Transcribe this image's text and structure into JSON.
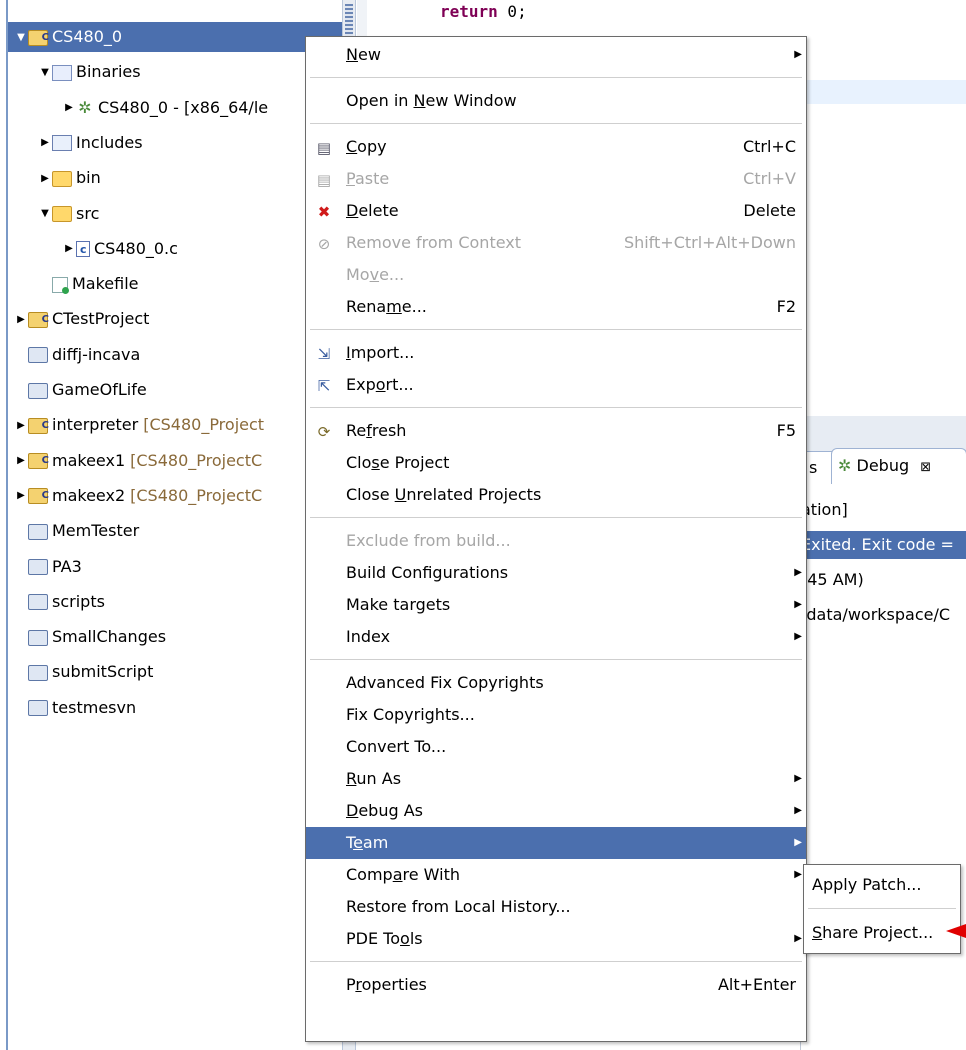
{
  "explorer": {
    "items": [
      {
        "label": "CS480_0",
        "level": 0,
        "twisty": "down",
        "icon": "project-folder-icon",
        "selected": true
      },
      {
        "label": "Binaries",
        "level": 1,
        "twisty": "down",
        "icon": "binaries-icon"
      },
      {
        "label": "CS480_0 - [x86_64/le",
        "level": 2,
        "twisty": "right",
        "icon": "executable-gear-icon"
      },
      {
        "label": "Includes",
        "level": 1,
        "twisty": "right",
        "icon": "includes-icon"
      },
      {
        "label": "bin",
        "level": 1,
        "twisty": "right",
        "icon": "folder-icon"
      },
      {
        "label": "src",
        "level": 1,
        "twisty": "down",
        "icon": "folder-icon"
      },
      {
        "label": "CS480_0.c",
        "level": 2,
        "twisty": "right",
        "icon": "c-file-icon"
      },
      {
        "label": "Makefile",
        "level": 1,
        "twisty": "",
        "icon": "makefile-icon"
      },
      {
        "label": "CTestProject",
        "level": 0,
        "twisty": "right",
        "icon": "project-folder-icon"
      },
      {
        "label": "diffj-incava",
        "level": 0,
        "twisty": "",
        "icon": "closed-project-icon"
      },
      {
        "label": "GameOfLife",
        "level": 0,
        "twisty": "",
        "icon": "closed-project-icon"
      },
      {
        "label": "interpreter",
        "decoration": "[CS480_Project",
        "level": 0,
        "twisty": "right",
        "icon": "shared-project-icon"
      },
      {
        "label": "makeex1",
        "decoration": "[CS480_ProjectC",
        "level": 0,
        "twisty": "right",
        "icon": "shared-project-icon"
      },
      {
        "label": "makeex2",
        "decoration": "[CS480_ProjectC",
        "level": 0,
        "twisty": "right",
        "icon": "shared-project-icon"
      },
      {
        "label": "MemTester",
        "level": 0,
        "twisty": "",
        "icon": "closed-project-icon"
      },
      {
        "label": "PA3",
        "level": 0,
        "twisty": "",
        "icon": "closed-project-icon"
      },
      {
        "label": "scripts",
        "level": 0,
        "twisty": "",
        "icon": "closed-project-icon"
      },
      {
        "label": "SmallChanges",
        "level": 0,
        "twisty": "",
        "icon": "closed-project-icon"
      },
      {
        "label": "submitScript",
        "level": 0,
        "twisty": "",
        "icon": "closed-project-icon"
      },
      {
        "label": "testmesvn",
        "level": 0,
        "twisty": "",
        "icon": "closed-project-icon"
      }
    ]
  },
  "editor": {
    "code_keyword": "return",
    "code_rest": " 0;"
  },
  "debug_view": {
    "prev_tab": "s",
    "tab_label": "Debug",
    "rows": [
      {
        "text": "ation]",
        "selected": false
      },
      {
        "text": "Exited. Exit code =",
        "selected": true
      },
      {
        "text": "(45 AM)",
        "selected": false
      },
      {
        "text": "/data/workspace/C",
        "selected": false
      }
    ]
  },
  "context_menu": {
    "items": [
      {
        "type": "item",
        "pre": "",
        "u": "N",
        "post": "ew",
        "accel": "",
        "arrow": true,
        "disabled": false,
        "icon": "",
        "name": "menu-new"
      },
      {
        "type": "sep"
      },
      {
        "type": "item",
        "pre": "Open in ",
        "u": "N",
        "post": "ew Window",
        "accel": "",
        "arrow": false,
        "disabled": false,
        "icon": "",
        "name": "menu-open-new-window"
      },
      {
        "type": "sep"
      },
      {
        "type": "item",
        "pre": "",
        "u": "C",
        "post": "opy",
        "accel": "Ctrl+C",
        "arrow": false,
        "disabled": false,
        "icon": "copy-icon",
        "name": "menu-copy"
      },
      {
        "type": "item",
        "pre": "",
        "u": "P",
        "post": "aste",
        "accel": "Ctrl+V",
        "arrow": false,
        "disabled": true,
        "icon": "paste-icon",
        "name": "menu-paste"
      },
      {
        "type": "item",
        "pre": "",
        "u": "D",
        "post": "elete",
        "accel": "Delete",
        "arrow": false,
        "disabled": false,
        "icon": "delete-icon",
        "name": "menu-delete"
      },
      {
        "type": "item",
        "pre": "Remove from Context",
        "u": "",
        "post": "",
        "accel": "Shift+Ctrl+Alt+Down",
        "arrow": false,
        "disabled": true,
        "icon": "remove-context-icon",
        "name": "menu-remove-from-context"
      },
      {
        "type": "item",
        "pre": "Mo",
        "u": "v",
        "post": "e...",
        "accel": "",
        "arrow": false,
        "disabled": true,
        "icon": "",
        "name": "menu-move"
      },
      {
        "type": "item",
        "pre": "Rena",
        "u": "m",
        "post": "e...",
        "accel": "F2",
        "arrow": false,
        "disabled": false,
        "icon": "",
        "name": "menu-rename"
      },
      {
        "type": "sep"
      },
      {
        "type": "item",
        "pre": "",
        "u": "I",
        "post": "mport...",
        "accel": "",
        "arrow": false,
        "disabled": false,
        "icon": "import-icon",
        "name": "menu-import"
      },
      {
        "type": "item",
        "pre": "Exp",
        "u": "o",
        "post": "rt...",
        "accel": "",
        "arrow": false,
        "disabled": false,
        "icon": "export-icon",
        "name": "menu-export"
      },
      {
        "type": "sep"
      },
      {
        "type": "item",
        "pre": "Re",
        "u": "f",
        "post": "resh",
        "accel": "F5",
        "arrow": false,
        "disabled": false,
        "icon": "refresh-icon",
        "name": "menu-refresh"
      },
      {
        "type": "item",
        "pre": "Clo",
        "u": "s",
        "post": "e Project",
        "accel": "",
        "arrow": false,
        "disabled": false,
        "icon": "",
        "name": "menu-close-project"
      },
      {
        "type": "item",
        "pre": "Close ",
        "u": "U",
        "post": "nrelated Projects",
        "accel": "",
        "arrow": false,
        "disabled": false,
        "icon": "",
        "name": "menu-close-unrelated"
      },
      {
        "type": "sep"
      },
      {
        "type": "item",
        "pre": "Exclude from build...",
        "u": "",
        "post": "",
        "accel": "",
        "arrow": false,
        "disabled": true,
        "icon": "",
        "name": "menu-exclude-build"
      },
      {
        "type": "item",
        "pre": "Build Configurations",
        "u": "",
        "post": "",
        "accel": "",
        "arrow": true,
        "disabled": false,
        "icon": "",
        "name": "menu-build-configurations"
      },
      {
        "type": "item",
        "pre": "Make targets",
        "u": "",
        "post": "",
        "accel": "",
        "arrow": true,
        "disabled": false,
        "icon": "",
        "name": "menu-make-targets"
      },
      {
        "type": "item",
        "pre": "Index",
        "u": "",
        "post": "",
        "accel": "",
        "arrow": true,
        "disabled": false,
        "icon": "",
        "name": "menu-index"
      },
      {
        "type": "sep"
      },
      {
        "type": "item",
        "pre": "Advanced Fix Copyrights",
        "u": "",
        "post": "",
        "accel": "",
        "arrow": false,
        "disabled": false,
        "icon": "",
        "name": "menu-advanced-fix-copyrights"
      },
      {
        "type": "item",
        "pre": "Fix Copyrights...",
        "u": "",
        "post": "",
        "accel": "",
        "arrow": false,
        "disabled": false,
        "icon": "",
        "name": "menu-fix-copyrights"
      },
      {
        "type": "item",
        "pre": "Convert To...",
        "u": "",
        "post": "",
        "accel": "",
        "arrow": false,
        "disabled": false,
        "icon": "",
        "name": "menu-convert-to"
      },
      {
        "type": "item",
        "pre": "",
        "u": "R",
        "post": "un As",
        "accel": "",
        "arrow": true,
        "disabled": false,
        "icon": "",
        "name": "menu-run-as"
      },
      {
        "type": "item",
        "pre": "",
        "u": "D",
        "post": "ebug As",
        "accel": "",
        "arrow": true,
        "disabled": false,
        "icon": "",
        "name": "menu-debug-as"
      },
      {
        "type": "item",
        "pre": "T",
        "u": "e",
        "post": "am",
        "accel": "",
        "arrow": true,
        "disabled": false,
        "icon": "",
        "name": "menu-team",
        "highlighted": true
      },
      {
        "type": "item",
        "pre": "Comp",
        "u": "a",
        "post": "re With",
        "accel": "",
        "arrow": true,
        "disabled": false,
        "icon": "",
        "name": "menu-compare-with"
      },
      {
        "type": "item",
        "pre": "Restore from Local History...",
        "u": "",
        "post": "",
        "accel": "",
        "arrow": false,
        "disabled": false,
        "icon": "",
        "name": "menu-restore-local-history"
      },
      {
        "type": "item",
        "pre": "PDE To",
        "u": "o",
        "post": "ls",
        "accel": "",
        "arrow": true,
        "disabled": false,
        "icon": "",
        "name": "menu-pde-tools"
      },
      {
        "type": "sep"
      },
      {
        "type": "item",
        "pre": "P",
        "u": "r",
        "post": "operties",
        "accel": "Alt+Enter",
        "arrow": false,
        "disabled": false,
        "icon": "",
        "name": "menu-properties"
      }
    ]
  },
  "team_submenu": {
    "items": [
      {
        "type": "item",
        "pre": "Apply Patch...",
        "u": "",
        "post": "",
        "name": "submenu-apply-patch"
      },
      {
        "type": "sep"
      },
      {
        "type": "item",
        "pre": "",
        "u": "S",
        "post": "hare Project...",
        "name": "submenu-share-project"
      }
    ]
  },
  "colors": {
    "selection": "#4b6fae",
    "decoration": "#8a6a3a",
    "disabled": "#a6a6a6",
    "annotation_arrow": "#e00000"
  }
}
